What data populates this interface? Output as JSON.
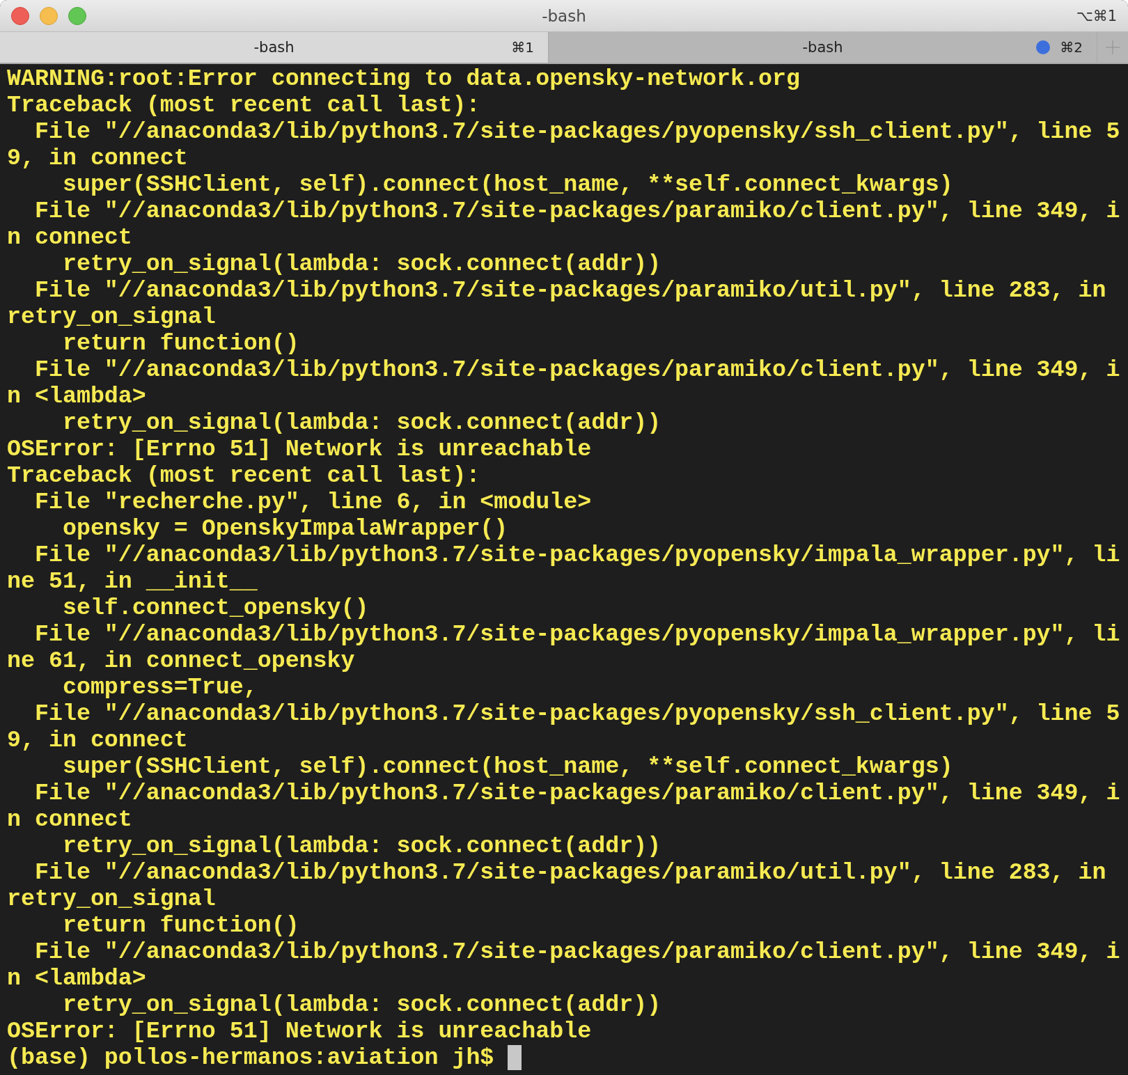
{
  "window": {
    "title": "-bash",
    "shortcut": "⌥⌘1"
  },
  "tabs": [
    {
      "label": "-bash",
      "shortcut": "⌘1",
      "selected": true,
      "activity": false
    },
    {
      "label": "-bash",
      "shortcut": "⌘2",
      "selected": false,
      "activity": true
    }
  ],
  "terminal": {
    "lines": [
      "WARNING:root:Error connecting to data.opensky-network.org",
      "Traceback (most recent call last):",
      "  File \"//anaconda3/lib/python3.7/site-packages/pyopensky/ssh_client.py\", line 5",
      "9, in connect",
      "    super(SSHClient, self).connect(host_name, **self.connect_kwargs)",
      "  File \"//anaconda3/lib/python3.7/site-packages/paramiko/client.py\", line 349, i",
      "n connect",
      "    retry_on_signal(lambda: sock.connect(addr))",
      "  File \"//anaconda3/lib/python3.7/site-packages/paramiko/util.py\", line 283, in",
      "retry_on_signal",
      "    return function()",
      "  File \"//anaconda3/lib/python3.7/site-packages/paramiko/client.py\", line 349, i",
      "n <lambda>",
      "    retry_on_signal(lambda: sock.connect(addr))",
      "OSError: [Errno 51] Network is unreachable",
      "Traceback (most recent call last):",
      "  File \"recherche.py\", line 6, in <module>",
      "    opensky = OpenskyImpalaWrapper()",
      "  File \"//anaconda3/lib/python3.7/site-packages/pyopensky/impala_wrapper.py\", li",
      "ne 51, in __init__",
      "    self.connect_opensky()",
      "  File \"//anaconda3/lib/python3.7/site-packages/pyopensky/impala_wrapper.py\", li",
      "ne 61, in connect_opensky",
      "    compress=True,",
      "  File \"//anaconda3/lib/python3.7/site-packages/pyopensky/ssh_client.py\", line 5",
      "9, in connect",
      "    super(SSHClient, self).connect(host_name, **self.connect_kwargs)",
      "  File \"//anaconda3/lib/python3.7/site-packages/paramiko/client.py\", line 349, i",
      "n connect",
      "    retry_on_signal(lambda: sock.connect(addr))",
      "  File \"//anaconda3/lib/python3.7/site-packages/paramiko/util.py\", line 283, in",
      "retry_on_signal",
      "    return function()",
      "  File \"//anaconda3/lib/python3.7/site-packages/paramiko/client.py\", line 349, i",
      "n <lambda>",
      "    retry_on_signal(lambda: sock.connect(addr))",
      "OSError: [Errno 51] Network is unreachable"
    ],
    "prompt": "(base) pollos-hermanos:aviation jh$"
  }
}
